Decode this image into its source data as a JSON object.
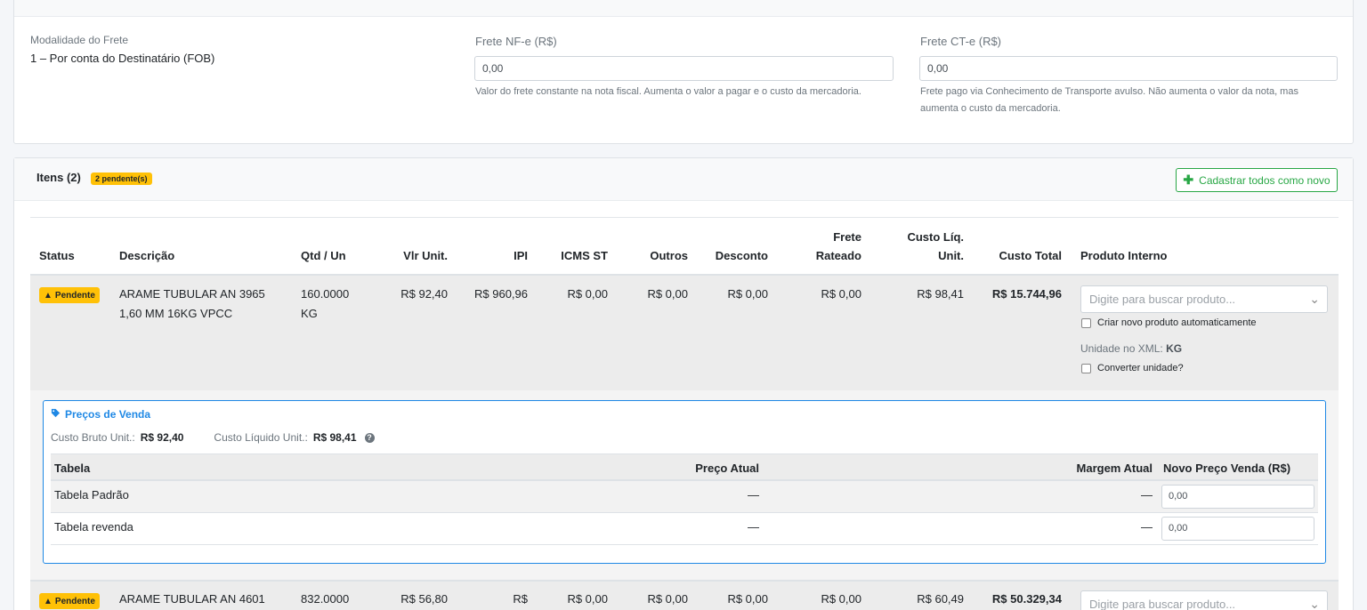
{
  "transport": {
    "modalidade_label": "Modalidade do Frete",
    "modalidade_value": "1 – Por conta do Destinatário (FOB)",
    "frete_nfe_label": "Frete NF-e (R$)",
    "frete_nfe_value": "0,00",
    "frete_nfe_help": "Valor do frete constante na nota fiscal. Aumenta o valor a pagar e o custo da mercadoria.",
    "frete_cte_label": "Frete CT-e (R$)",
    "frete_cte_value": "0,00",
    "frete_cte_help": "Frete pago via Conhecimento de Transporte avulso. Não aumenta o valor da nota, mas aumenta o custo da mercadoria."
  },
  "items": {
    "title": "Itens (2)",
    "pending_badge": "2 pendente(s)",
    "add_all_label": "Cadastrar todos como novo",
    "headers": {
      "status": "Status",
      "descricao": "Descrição",
      "qtd": "Qtd / Un",
      "vlr_unit": "Vlr Unit.",
      "ipi": "IPI",
      "icms_st": "ICMS ST",
      "outros": "Outros",
      "desconto": "Desconto",
      "frete_1": "Frete",
      "frete_2": "Rateado",
      "custo_liq_1": "Custo Líq.",
      "custo_liq_2": "Unit.",
      "custo_total": "Custo Total",
      "produto_interno": "Produto Interno"
    },
    "rows": [
      {
        "status": "Pendente",
        "desc_1": "ARAME TUBULAR AN 3965",
        "desc_2": "1,60 MM 16KG VPCC",
        "qtd_1": "160.0000",
        "qtd_2": "KG",
        "vlr_unit": "R$ 92,40",
        "ipi": "R$ 960,96",
        "icms_st": "R$ 0,00",
        "outros": "R$ 0,00",
        "desconto": "R$ 0,00",
        "frete": "R$ 0,00",
        "custo_liq": "R$ 98,41",
        "custo_total": "R$ 15.744,96",
        "search_placeholder": "Digite para buscar produto...",
        "criar_novo": "Criar novo produto automaticamente",
        "unidade_label": "Unidade no XML:",
        "unidade_value": "KG",
        "converter": "Converter unidade?"
      },
      {
        "status": "Pendente",
        "desc_1": "ARAME TUBULAR AN 4601",
        "qtd_1": "832.0000",
        "vlr_unit": "R$ 56,80",
        "ipi": "R$",
        "icms_st": "R$ 0,00",
        "outros": "R$ 0,00",
        "desconto": "R$ 0,00",
        "frete": "R$ 0,00",
        "custo_liq": "R$ 60,49",
        "custo_total": "R$ 50.329,34",
        "search_placeholder": "Digite para buscar produto..."
      }
    ],
    "precos": {
      "title": "Preços de Venda",
      "custo_bruto_label": "Custo Bruto Unit.:",
      "custo_bruto_value": "R$ 92,40",
      "custo_liquido_label": "Custo Líquido Unit.:",
      "custo_liquido_value": "R$ 98,41",
      "col_tabela": "Tabela",
      "col_preco_atual": "Preço Atual",
      "col_margem": "Margem Atual",
      "col_novo_preco": "Novo Preço Venda (R$)",
      "rows": [
        {
          "tabela": "Tabela Padrão",
          "preco_atual": "—",
          "margem": "—",
          "novo_preco": "0,00"
        },
        {
          "tabela": "Tabela revenda",
          "preco_atual": "—",
          "margem": "—",
          "novo_preco": "0,00"
        }
      ]
    }
  }
}
